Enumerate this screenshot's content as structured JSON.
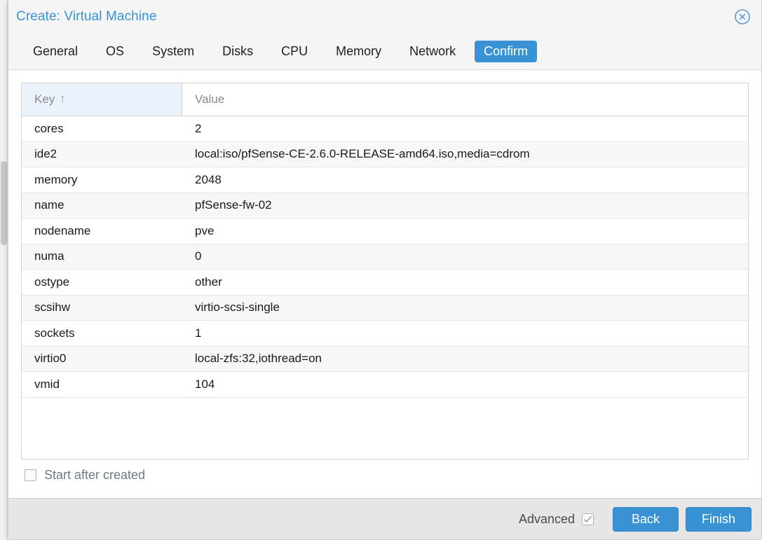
{
  "dialog": {
    "title": "Create: Virtual Machine",
    "close_icon": "close-circle-icon"
  },
  "tabs": [
    {
      "label": "General",
      "active": false
    },
    {
      "label": "OS",
      "active": false
    },
    {
      "label": "System",
      "active": false
    },
    {
      "label": "Disks",
      "active": false
    },
    {
      "label": "CPU",
      "active": false
    },
    {
      "label": "Memory",
      "active": false
    },
    {
      "label": "Network",
      "active": false
    },
    {
      "label": "Confirm",
      "active": true
    }
  ],
  "grid": {
    "columns": [
      {
        "label": "Key",
        "sorted": true,
        "sort_arrow": "↑"
      },
      {
        "label": "Value",
        "sorted": false,
        "sort_arrow": ""
      }
    ],
    "rows": [
      {
        "key": "cores",
        "value": "2"
      },
      {
        "key": "ide2",
        "value": "local:iso/pfSense-CE-2.6.0-RELEASE-amd64.iso,media=cdrom"
      },
      {
        "key": "memory",
        "value": "2048"
      },
      {
        "key": "name",
        "value": "pfSense-fw-02"
      },
      {
        "key": "nodename",
        "value": "pve"
      },
      {
        "key": "numa",
        "value": "0"
      },
      {
        "key": "ostype",
        "value": "other"
      },
      {
        "key": "scsihw",
        "value": "virtio-scsi-single"
      },
      {
        "key": "sockets",
        "value": "1"
      },
      {
        "key": "virtio0",
        "value": "local-zfs:32,iothread=on"
      },
      {
        "key": "vmid",
        "value": "104"
      }
    ]
  },
  "start_after_created": {
    "label": "Start after created",
    "checked": false
  },
  "footer": {
    "advanced_label": "Advanced",
    "advanced_checked": true,
    "back_label": "Back",
    "finish_label": "Finish"
  },
  "colors": {
    "accent": "#3892d4",
    "title": "#3892d4",
    "header_bg": "#f5f5f5",
    "footer_bg": "#e6e6e6",
    "sorted_col_bg": "#eaf2fb",
    "row_alt_bg": "#f7f7f7"
  }
}
